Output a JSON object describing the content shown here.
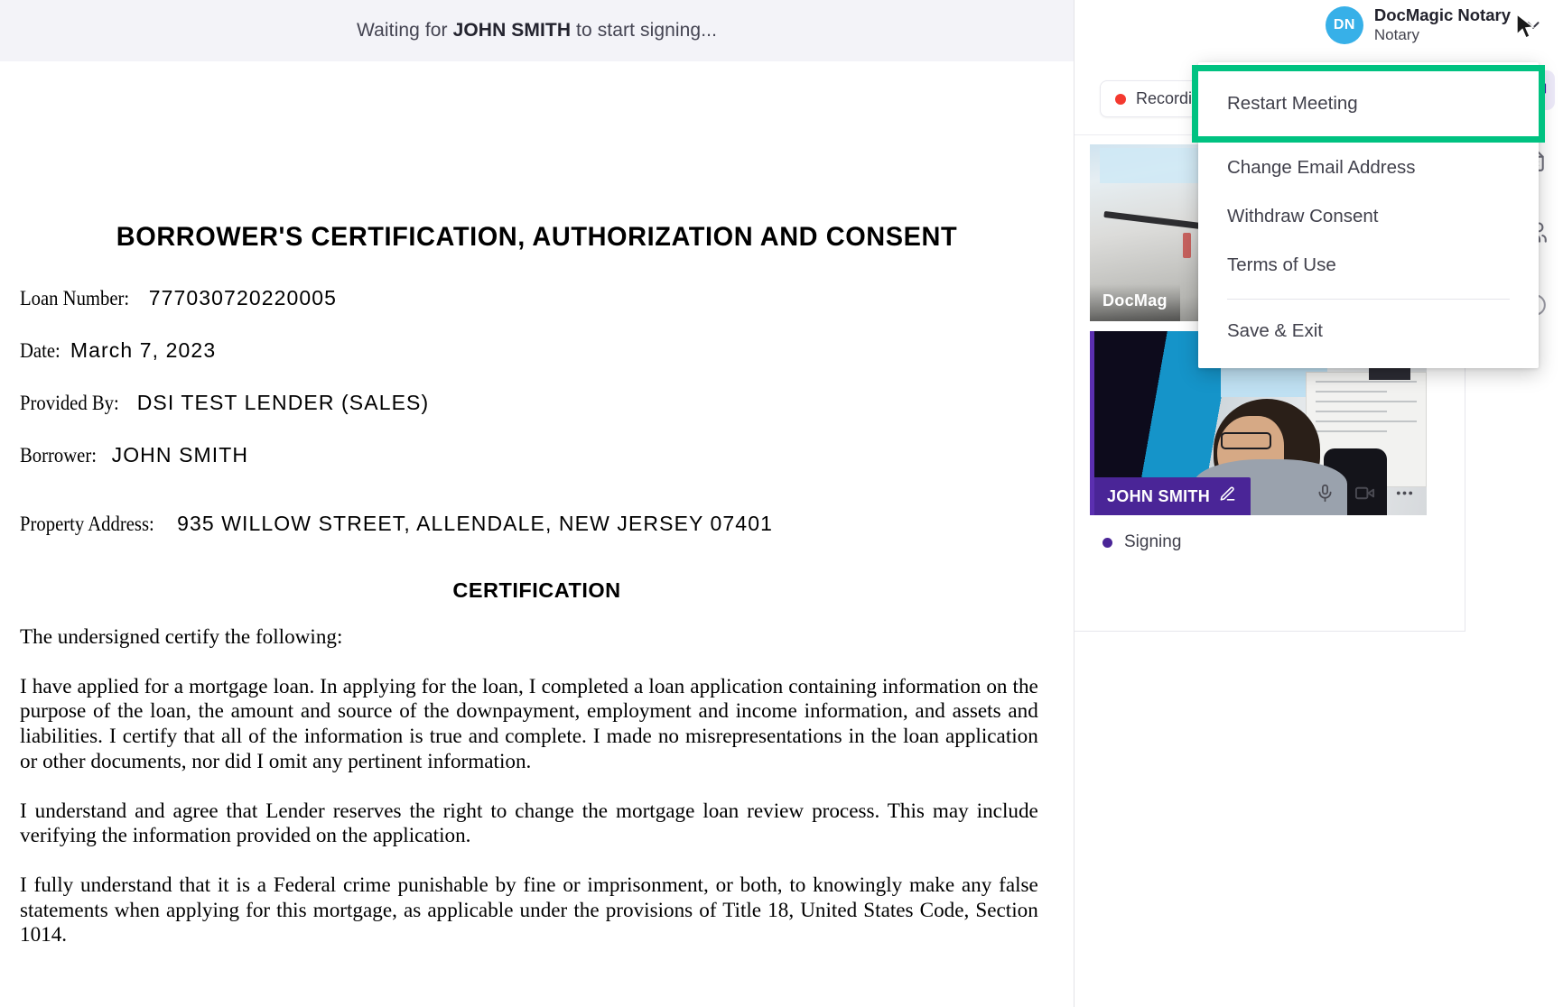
{
  "document_pane": {
    "waiting_banner": {
      "prefix": "Waiting for ",
      "name": "JOHN SMITH",
      "suffix": " to start signing..."
    },
    "title": "BORROWER'S CERTIFICATION, AUTHORIZATION AND CONSENT",
    "fields": [
      {
        "label": "Loan Number:",
        "value": "777030720220005"
      },
      {
        "label": "Date:",
        "value": "March 7, 2023"
      },
      {
        "label": "Provided By:",
        "value": "DSI TEST LENDER (SALES)"
      },
      {
        "label": "Borrower:",
        "value": "JOHN SMITH"
      },
      {
        "label": "Property Address:",
        "value": "935 WILLOW STREET, ALLENDALE, NEW JERSEY 07401"
      }
    ],
    "section_title": "CERTIFICATION",
    "paragraphs": [
      "The undersigned certify the following:",
      "I have applied for a mortgage loan. In applying for the loan, I completed a loan application containing information on the purpose of the loan, the amount and source of the downpayment, employment and income information, and assets and liabilities. I certify that all of the information is true and complete. I made no misrepresentations in the loan application or other documents, nor did I omit any pertinent information.",
      "I understand and agree that Lender reserves the right to change the mortgage loan review process. This may include verifying the information provided on the application.",
      "I fully understand that it is a Federal crime punishable by fine or imprisonment, or both, to knowingly make any false statements when applying for this mortgage, as applicable under the provisions of Title 18, United States Code, Section 1014."
    ]
  },
  "meeting_panel": {
    "identity": {
      "avatar_initials": "DN",
      "name": "DocMagic Notary",
      "role": "Notary"
    },
    "recording": {
      "label": "Recording"
    },
    "tiles": [
      {
        "name": "DocMagic Notary",
        "name_truncated": "DocMag"
      },
      {
        "name": "JOHN SMITH"
      }
    ],
    "participant_status": "Signing",
    "tile_controls": [
      {
        "icon": "microphone-icon"
      },
      {
        "icon": "video-camera-icon"
      },
      {
        "icon": "more-options-icon"
      }
    ],
    "rail": [
      {
        "icon": "video-camera-icon",
        "active": true
      },
      {
        "icon": "document-icon",
        "active": false
      },
      {
        "icon": "participants-icon",
        "active": false
      },
      {
        "icon": "info-icon",
        "active": false
      }
    ]
  },
  "dropdown_menu": {
    "highlighted_item": "Restart Meeting",
    "items": [
      "Change Email Address",
      "Withdraw Consent",
      "Terms of Use"
    ],
    "footer_item": "Save & Exit",
    "highlight_color": "#00c281"
  }
}
